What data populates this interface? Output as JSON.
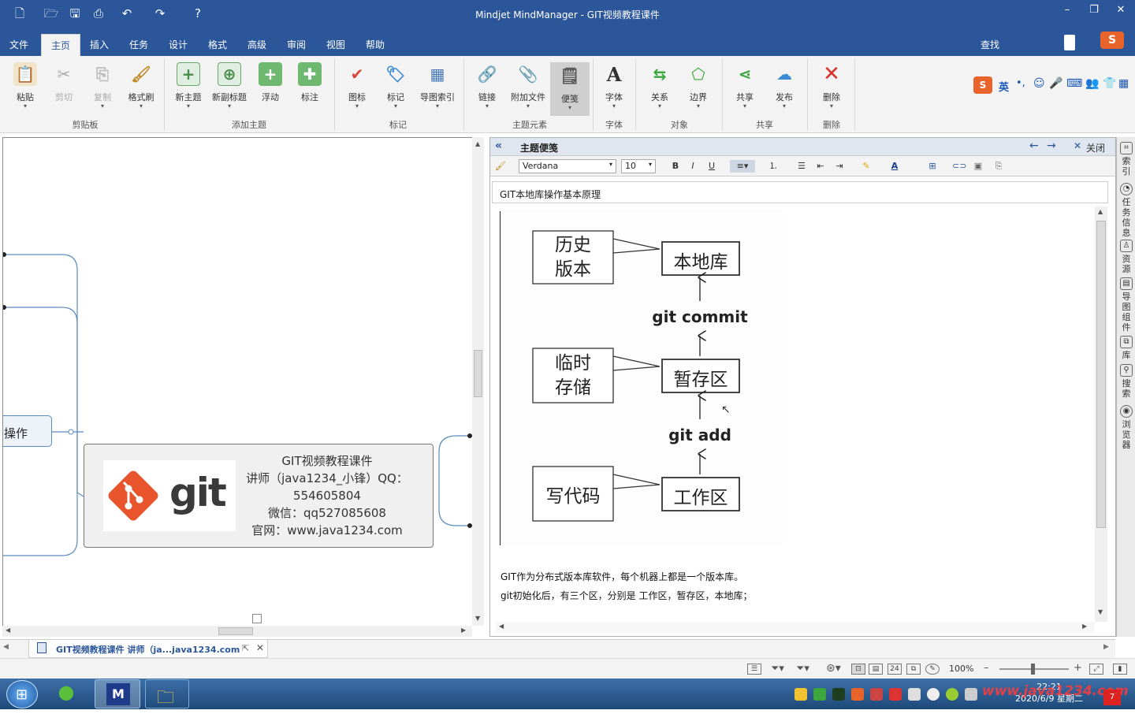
{
  "app_title": "Mindjet MindManager - GIT视频教程课件",
  "window_controls": {
    "minimize": "–",
    "restore": "❐",
    "close": "✕"
  },
  "menu": [
    "文件",
    "主页",
    "插入",
    "任务",
    "设计",
    "格式",
    "高级",
    "审阅",
    "视图",
    "帮助"
  ],
  "search_label": "查找",
  "ribbon": {
    "buttons": [
      "粘贴",
      "剪切",
      "复制",
      "格式刷",
      "新主题",
      "新副标题",
      "浮动",
      "标注",
      "图标",
      "标记",
      "导图索引",
      "链接",
      "附加文件",
      "便笺",
      "字体",
      "关系",
      "边界",
      "共享",
      "发布",
      "删除"
    ],
    "groups": [
      "剪贴板",
      "添加主题",
      "标记",
      "主题元素",
      "字体",
      "对象",
      "共享",
      "删除"
    ]
  },
  "ime": {
    "mode": "英"
  },
  "map": {
    "left_topic": "操作",
    "central_lines": [
      "GIT视频教程课件",
      "讲师（java1234_小锋）QQ：",
      "554605804",
      "微信：qq527085608",
      "官网：www.java1234.com"
    ],
    "logo_text": "git"
  },
  "notes_panel": {
    "title": "主题便笺",
    "close_label": "关闭",
    "font_name": "Verdana",
    "font_size": "10",
    "bold": "B",
    "italic": "I",
    "underline": "U",
    "topic_name": "GIT本地库操作基本原理",
    "diagram": {
      "left_boxes": [
        [
          "历史",
          "版本"
        ],
        [
          "临时",
          "存储"
        ],
        [
          "写代码"
        ]
      ],
      "right_boxes": [
        "本地库",
        "暂存区",
        "工作区"
      ],
      "commands": [
        "git commit",
        "git add"
      ]
    },
    "body_lines": [
      "GIT作为分布式版本库软件，每个机器上都是一个版本库。",
      "git初始化后，有三个区，分别是 工作区，暂存区，本地库；"
    ]
  },
  "right_panel": [
    "索引",
    "任务信息",
    "资源",
    "导图组件",
    "库",
    "搜索",
    "浏览器"
  ],
  "doc_tab": "GIT视频教程课件 讲师（ja...java1234.com",
  "status": {
    "zoom": "100%"
  },
  "clock": {
    "time": "22:21",
    "date": "2020/6/9 星期二"
  },
  "watermark": "www.java1234.com"
}
